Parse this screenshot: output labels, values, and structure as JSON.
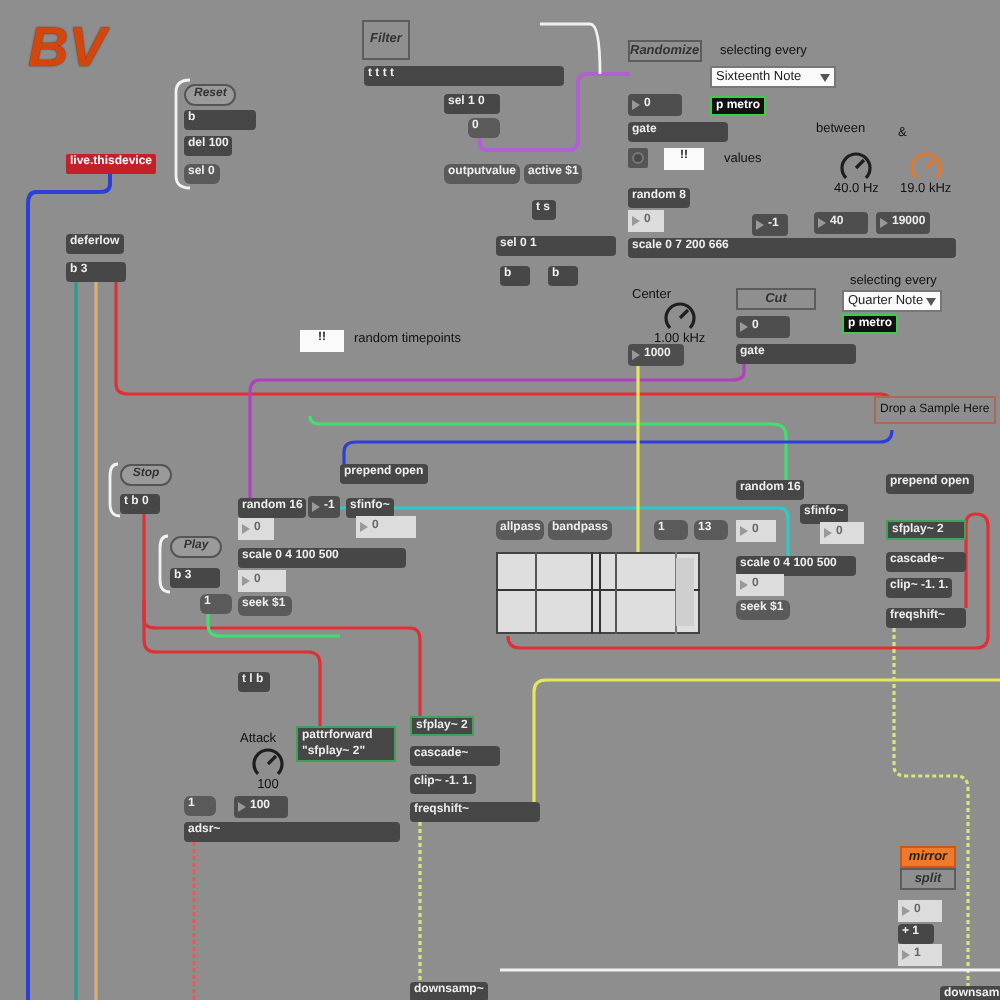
{
  "logo": {
    "text": "BV"
  },
  "objects": [
    {
      "kind": "textbutton",
      "text": "Filter",
      "on": false
    },
    {
      "kind": "object",
      "text": "t t t t"
    },
    {
      "kind": "pill",
      "text": "Reset"
    },
    {
      "kind": "object",
      "text": "b"
    },
    {
      "kind": "object",
      "text": "del 100"
    },
    {
      "kind": "message",
      "text": "sel 0"
    },
    {
      "kind": "device",
      "text": "live.thisdevice"
    },
    {
      "kind": "object",
      "text": "sel 1 0"
    },
    {
      "kind": "message",
      "text": "0"
    },
    {
      "kind": "message",
      "text": "outputvalue"
    },
    {
      "kind": "message",
      "text": "active $1"
    },
    {
      "kind": "object",
      "text": "t s"
    },
    {
      "kind": "object",
      "text": "deferlow"
    },
    {
      "kind": "object",
      "text": "b 3"
    },
    {
      "kind": "textbutton",
      "text": "Randomize",
      "on": false
    },
    {
      "kind": "comment",
      "text": "selecting every"
    },
    {
      "kind": "menu",
      "text": "Sixteenth Note"
    },
    {
      "kind": "dark-number",
      "text": "0"
    },
    {
      "kind": "metro",
      "text": "p metro"
    },
    {
      "kind": "object",
      "text": "gate"
    },
    {
      "kind": "toggle",
      "on": false
    },
    {
      "kind": "white-message",
      "text": "!!"
    },
    {
      "kind": "comment",
      "text": "values"
    },
    {
      "kind": "comment",
      "text": "between"
    },
    {
      "kind": "comment",
      "text": "&"
    },
    {
      "kind": "dial",
      "reading": "40.0 Hz",
      "color": "#1e1e1e"
    },
    {
      "kind": "dial",
      "reading": "19.0 kHz",
      "color": "#e0782f"
    },
    {
      "kind": "object",
      "text": "random 8"
    },
    {
      "kind": "number",
      "text": "0"
    },
    {
      "kind": "dark-number",
      "text": "-1"
    },
    {
      "kind": "dark-number",
      "text": "40"
    },
    {
      "kind": "dark-number",
      "text": "19000"
    },
    {
      "kind": "object",
      "text": "sel 0 1"
    },
    {
      "kind": "object",
      "text": "scale 0 7 200 666"
    },
    {
      "kind": "object",
      "text": "b"
    },
    {
      "kind": "object",
      "text": "b"
    },
    {
      "kind": "comment",
      "text": "selecting every"
    },
    {
      "kind": "menu",
      "text": "Quarter Note"
    },
    {
      "kind": "comment",
      "text": "Center"
    },
    {
      "kind": "dial",
      "reading": "1.00 kHz",
      "color": "#1e1e1e"
    },
    {
      "kind": "textbutton",
      "text": "Cut",
      "on": false
    },
    {
      "kind": "dark-number",
      "text": "0"
    },
    {
      "kind": "metro",
      "text": "p metro"
    },
    {
      "kind": "object",
      "text": "gate"
    },
    {
      "kind": "dark-number",
      "text": "1000"
    },
    {
      "kind": "white-message",
      "text": "!!"
    },
    {
      "kind": "comment",
      "text": "random timepoints"
    },
    {
      "kind": "dropzone",
      "text": "Drop a Sample Here"
    },
    {
      "kind": "pill",
      "text": "Stop"
    },
    {
      "kind": "object",
      "text": "t b 0"
    },
    {
      "kind": "object",
      "text": "prepend open"
    },
    {
      "kind": "object",
      "text": "prepend open"
    },
    {
      "kind": "object",
      "text": "random 16"
    },
    {
      "kind": "dark-number",
      "text": "-1"
    },
    {
      "kind": "object",
      "text": "sfinfo~"
    },
    {
      "kind": "object",
      "text": "random 16"
    },
    {
      "kind": "object",
      "text": "sfinfo~"
    },
    {
      "kind": "number",
      "text": "0"
    },
    {
      "kind": "number",
      "text": "0"
    },
    {
      "kind": "number",
      "text": "0"
    },
    {
      "kind": "number",
      "text": "0"
    },
    {
      "kind": "pill",
      "text": "Play"
    },
    {
      "kind": "object",
      "text": "b 3"
    },
    {
      "kind": "object",
      "text": "scale 0 4 100 500"
    },
    {
      "kind": "object",
      "text": "scale 0 4 100 500"
    },
    {
      "kind": "active",
      "text": "sfplay~ 2"
    },
    {
      "kind": "object",
      "text": "cascade~"
    },
    {
      "kind": "object",
      "text": "clip~ -1. 1."
    },
    {
      "kind": "object",
      "text": "freqshift~"
    },
    {
      "kind": "number",
      "text": "0"
    },
    {
      "kind": "number",
      "text": "0"
    },
    {
      "kind": "message",
      "text": "1"
    },
    {
      "kind": "message",
      "text": "seek $1"
    },
    {
      "kind": "message",
      "text": "seek $1"
    },
    {
      "kind": "message",
      "text": "allpass"
    },
    {
      "kind": "message",
      "text": "bandpass"
    },
    {
      "kind": "message",
      "text": "1"
    },
    {
      "kind": "message",
      "text": "13"
    },
    {
      "kind": "filtergraph"
    },
    {
      "kind": "object",
      "text": "t l b"
    },
    {
      "kind": "comment",
      "text": "Attack"
    },
    {
      "kind": "dial",
      "reading": "100",
      "color": "#1e1e1e"
    },
    {
      "kind": "active",
      "text": "pattrforward \"sfplay~ 2\""
    },
    {
      "kind": "active",
      "text": "sfplay~ 2"
    },
    {
      "kind": "object",
      "text": "cascade~"
    },
    {
      "kind": "object",
      "text": "clip~ -1. 1."
    },
    {
      "kind": "object",
      "text": "freqshift~"
    },
    {
      "kind": "message",
      "text": "1"
    },
    {
      "kind": "dark-number",
      "text": "100"
    },
    {
      "kind": "object",
      "text": "adsr~"
    },
    {
      "kind": "object",
      "text": "downsamp~"
    },
    {
      "kind": "object",
      "text": "downsam"
    },
    {
      "kind": "textbutton",
      "text": "mirror",
      "on": true
    },
    {
      "kind": "textbutton",
      "text": "split",
      "on": false
    },
    {
      "kind": "number",
      "text": "0"
    },
    {
      "kind": "object",
      "text": "+ 1"
    },
    {
      "kind": "number",
      "text": "1"
    }
  ]
}
